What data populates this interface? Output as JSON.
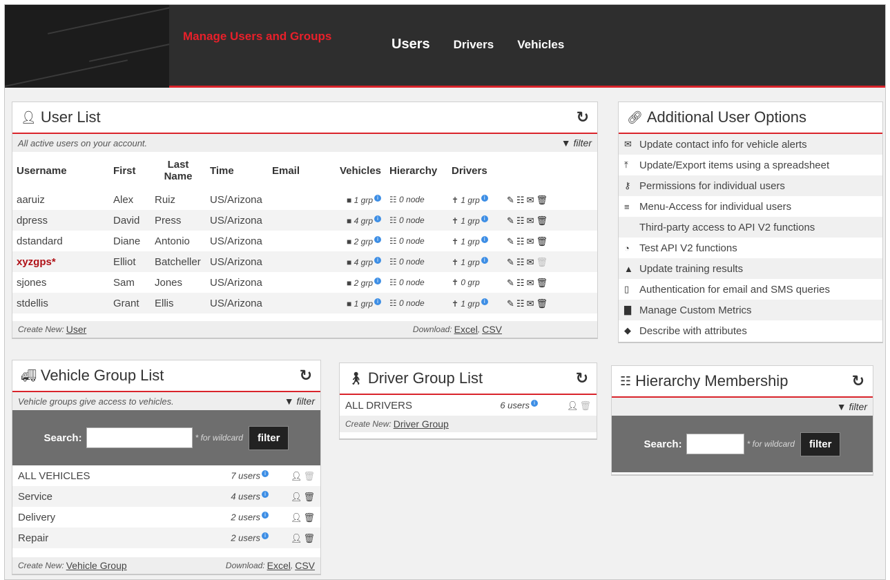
{
  "header": {
    "app_title": "Manage Users and Groups",
    "nav": [
      {
        "label": "Users",
        "active": true
      },
      {
        "label": "Drivers",
        "active": false
      },
      {
        "label": "Vehicles",
        "active": false
      }
    ]
  },
  "colors": {
    "accent": "#d9232a",
    "header_bg": "#2e2e2e",
    "highlight_user": "#b01218",
    "info_badge": "#3d8ee5"
  },
  "user_list": {
    "title": "User List",
    "subtitle": "All active users on your account.",
    "filter_label": "filter",
    "columns": {
      "username": "Username",
      "first": "First",
      "last": "Last Name",
      "time": "Time",
      "email": "Email",
      "vehicles": "Vehicles",
      "hierarchy": "Hierarchy",
      "drivers": "Drivers"
    },
    "rows": [
      {
        "username": "aaruiz",
        "first": "Alex",
        "last": "Ruiz",
        "time": "US/Arizona",
        "email": "",
        "vehicles": "1 grp",
        "hierarchy": "0 node",
        "drivers": "1 grp",
        "highlight": false,
        "delete_enabled": true
      },
      {
        "username": "dpress",
        "first": "David",
        "last": "Press",
        "time": "US/Arizona",
        "email": "",
        "vehicles": "4 grp",
        "hierarchy": "0 node",
        "drivers": "1 grp",
        "highlight": false,
        "delete_enabled": true
      },
      {
        "username": "dstandard",
        "first": "Diane",
        "last": "Antonio",
        "time": "US/Arizona",
        "email": "",
        "vehicles": "2 grp",
        "hierarchy": "0 node",
        "drivers": "1 grp",
        "highlight": false,
        "delete_enabled": true
      },
      {
        "username": "xyzgps*",
        "first": "Elliot",
        "last": "Batcheller",
        "time": "US/Arizona",
        "email": "",
        "vehicles": "4 grp",
        "hierarchy": "0 node",
        "drivers": "1 grp",
        "highlight": true,
        "delete_enabled": false
      },
      {
        "username": "sjones",
        "first": "Sam",
        "last": "Jones",
        "time": "US/Arizona",
        "email": "",
        "vehicles": "2 grp",
        "hierarchy": "0 node",
        "drivers": "0 grp",
        "highlight": false,
        "delete_enabled": true
      },
      {
        "username": "stdellis",
        "first": "Grant",
        "last": "Ellis",
        "time": "US/Arizona",
        "email": "",
        "vehicles": "1 grp",
        "hierarchy": "0 node",
        "drivers": "1 grp",
        "highlight": false,
        "delete_enabled": true
      }
    ],
    "footer": {
      "create_label": "Create New:",
      "create_link": "User",
      "download_label": "Download:",
      "excel": "Excel",
      "csv": "CSV"
    }
  },
  "options": {
    "title": "Additional User Options",
    "items": [
      {
        "label": "Update contact info for vehicle alerts",
        "icon": "envelope-icon"
      },
      {
        "label": "Update/Export items using a spreadsheet",
        "icon": "upload-icon"
      },
      {
        "label": "Permissions for individual users",
        "icon": "key-icon"
      },
      {
        "label": "Menu-Access for individual users",
        "icon": "menu-icon"
      },
      {
        "label": "Third-party access to API V2 functions",
        "icon": "code-icon"
      },
      {
        "label": "Test API V2 functions",
        "icon": "dashboard-icon"
      },
      {
        "label": "Update training results",
        "icon": "graduation-icon"
      },
      {
        "label": "Authentication for email and SMS queries",
        "icon": "mobile-icon"
      },
      {
        "label": "Manage Custom Metrics",
        "icon": "bar-chart-icon"
      },
      {
        "label": "Describe with attributes",
        "icon": "tag-icon"
      }
    ]
  },
  "vehicle_groups": {
    "title": "Vehicle Group List",
    "subtitle": "Vehicle groups give access to vehicles.",
    "filter_label": "filter",
    "search_label": "Search:",
    "wildcard_note": "* for wildcard",
    "filter_button": "filter",
    "rows": [
      {
        "name": "ALL VEHICLES",
        "count": "7 users",
        "delete_enabled": false
      },
      {
        "name": "Service",
        "count": "4 users",
        "delete_enabled": true
      },
      {
        "name": "Delivery",
        "count": "2 users",
        "delete_enabled": true
      },
      {
        "name": "Repair",
        "count": "2 users",
        "delete_enabled": true
      }
    ],
    "footer": {
      "create_label": "Create New:",
      "create_link": "Vehicle Group",
      "download_label": "Download:",
      "excel": "Excel",
      "csv": "CSV"
    }
  },
  "driver_groups": {
    "title": "Driver Group List",
    "rows": [
      {
        "name": "ALL DRIVERS",
        "count": "6 users",
        "delete_enabled": false
      }
    ],
    "footer": {
      "create_label": "Create New:",
      "create_link": "Driver Group"
    }
  },
  "hierarchy": {
    "title": "Hierarchy Membership",
    "filter_label": "filter",
    "search_label": "Search:",
    "wildcard_note": "* for wildcard",
    "filter_button": "filter"
  }
}
